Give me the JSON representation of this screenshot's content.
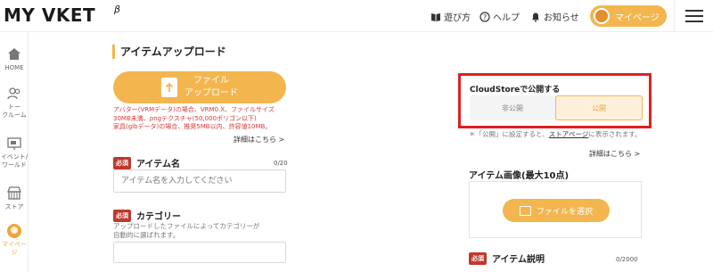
{
  "header": {
    "logo": "MY VKET",
    "logo_suffix": "β",
    "nav": [
      "遊び方",
      "ヘルプ",
      "お知らせ"
    ],
    "mypage_label": "マイページ"
  },
  "sidebar": {
    "items": [
      {
        "label": "HOME"
      },
      {
        "label": "トー\nクルーム"
      },
      {
        "label": "イベント/\nワールド"
      },
      {
        "label": "ストア"
      },
      {
        "label": "マイページ"
      }
    ]
  },
  "main": {
    "title": "アイテムアップロード",
    "file_upload_label": "ファイル\nアップロード",
    "warning": "アバター(VRMデータ)の場合、VRM0.X、ファイルサイズ\n30MB未満、pngテクスチャ(50,000ポリゴン以下)\n家具(glbデータ)の場合、推奨5MB以内、許容値10MB。",
    "detail_link": "詳細はこちら >",
    "item_name": {
      "badge": "必須",
      "label": "アイテム名",
      "counter": "0/20",
      "placeholder": "アイテム名を入力してください"
    },
    "category": {
      "badge": "必須",
      "label": "カテゴリー",
      "hint": "アップロードしたファイルによってカテゴリーが\n自動的に選ばれます。"
    }
  },
  "right": {
    "cloudstore": {
      "title": "CloudStoreで公開する",
      "options": [
        "非公開",
        "公開"
      ],
      "selected": "公開"
    },
    "note_prefix": "＊「公開」に設定すると、",
    "note_link": "ストアページ",
    "note_suffix": "に表示されます。",
    "detail_link": "詳細はこちら >",
    "image_label": "アイテム画像(最大10点)",
    "select_file_label": "ファイルを選択",
    "description": {
      "badge": "必須",
      "label": "アイテム説明",
      "counter": "0/2000"
    }
  },
  "colors": {
    "accent": "#f3b64e",
    "required": "#c0392b",
    "highlight_border": "#e02020",
    "warning_text": "#d9383a"
  }
}
